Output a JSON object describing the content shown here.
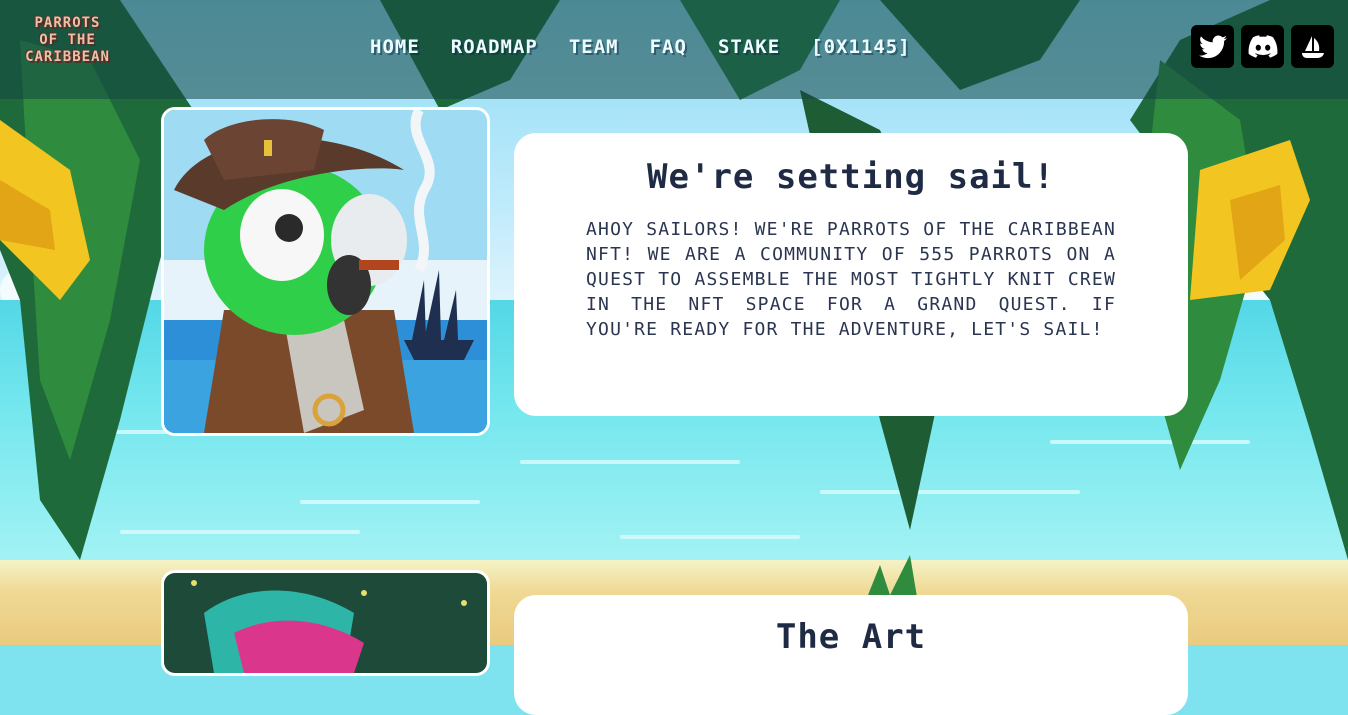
{
  "brand": {
    "logo_lines": [
      "PARROTS",
      "OF THE",
      "CARIBBEAN"
    ]
  },
  "nav": {
    "items": [
      "HOME",
      "ROADMAP",
      "TEAM",
      "FAQ",
      "STAKE",
      "[0X1145]"
    ]
  },
  "social": [
    {
      "icon": "twitter-icon"
    },
    {
      "icon": "discord-icon"
    },
    {
      "icon": "ship-icon"
    }
  ],
  "intro": {
    "title": "We're setting sail!",
    "body": "Ahoy sailors! We're Parrots of the Caribbean NFT! We are a community of 555 parrots on a quest to assemble the most tightly knit crew in the NFT space for a grand quest. If you're ready for the adventure, let's sail!"
  },
  "art": {
    "title": "The Art"
  },
  "colors": {
    "nav_overlay": "#1a4a4a",
    "panel": "#ffffff",
    "title_text": "#1f2a44",
    "parrot_green": "#2fcf4a"
  }
}
